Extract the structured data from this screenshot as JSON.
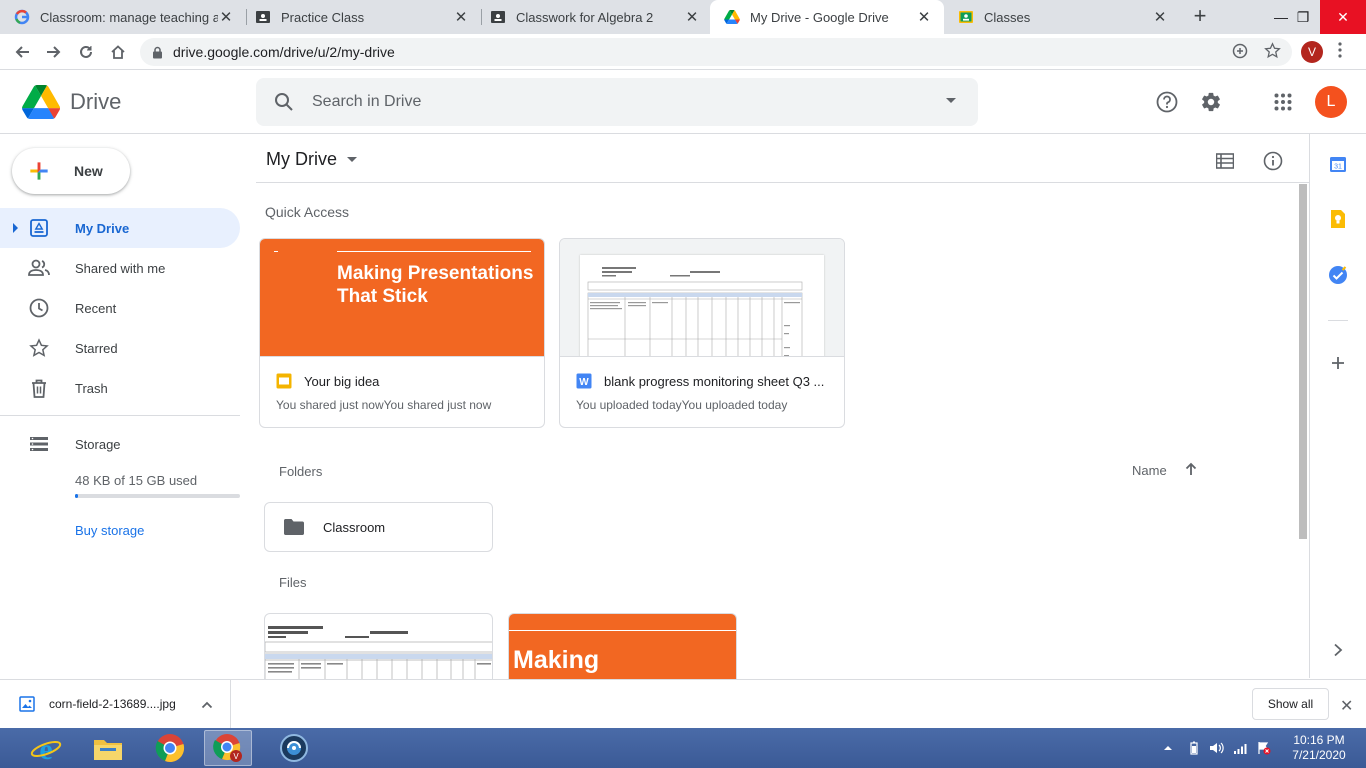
{
  "browser": {
    "tabs": [
      {
        "title": "Classroom: manage teaching an",
        "icon": "google-g-icon"
      },
      {
        "title": "Practice Class",
        "icon": "classroom-icon"
      },
      {
        "title": "Classwork for Algebra 2",
        "icon": "classroom-icon"
      },
      {
        "title": "My Drive - Google Drive",
        "icon": "drive-icon",
        "active": true
      },
      {
        "title": "Classes",
        "icon": "classroom-yellow-icon"
      }
    ],
    "url": "drive.google.com/drive/u/2/my-drive",
    "profile_initial": "V"
  },
  "drive": {
    "app_name": "Drive",
    "search_placeholder": "Search in Drive",
    "user_initial": "L"
  },
  "sidebar": {
    "new_label": "New",
    "items": [
      {
        "label": "My Drive",
        "icon": "my-drive-icon",
        "active": true
      },
      {
        "label": "Shared with me",
        "icon": "people-icon"
      },
      {
        "label": "Recent",
        "icon": "clock-icon"
      },
      {
        "label": "Starred",
        "icon": "star-icon"
      },
      {
        "label": "Trash",
        "icon": "trash-icon"
      }
    ],
    "storage_label": "Storage",
    "storage_usage": "48 KB of 15 GB used",
    "storage_fraction": 0.003,
    "buy_storage": "Buy storage"
  },
  "main": {
    "title": "My Drive",
    "quick_access_label": "Quick Access",
    "quick_access": [
      {
        "name": "Your big idea",
        "subtitle": "You shared just nowYou shared just now",
        "thumb_text": "Making Presentations That Stick",
        "type": "slides"
      },
      {
        "name": "blank progress monitoring sheet Q3 ...",
        "subtitle": "You uploaded todayYou uploaded today",
        "type": "word"
      }
    ],
    "folders_label": "Folders",
    "sort_label": "Name",
    "folders": [
      {
        "name": "Classroom"
      }
    ],
    "files_label": "Files",
    "file_thumb_text": "Making"
  },
  "download": {
    "filename": "corn-field-2-13689....jpg",
    "show_all": "Show all"
  },
  "taskbar": {
    "time": "10:16 PM",
    "date": "7/21/2020"
  },
  "colors": {
    "accent_blue": "#1a73e8",
    "slide_orange": "#f26722",
    "avatar_orange": "#f4511e"
  }
}
